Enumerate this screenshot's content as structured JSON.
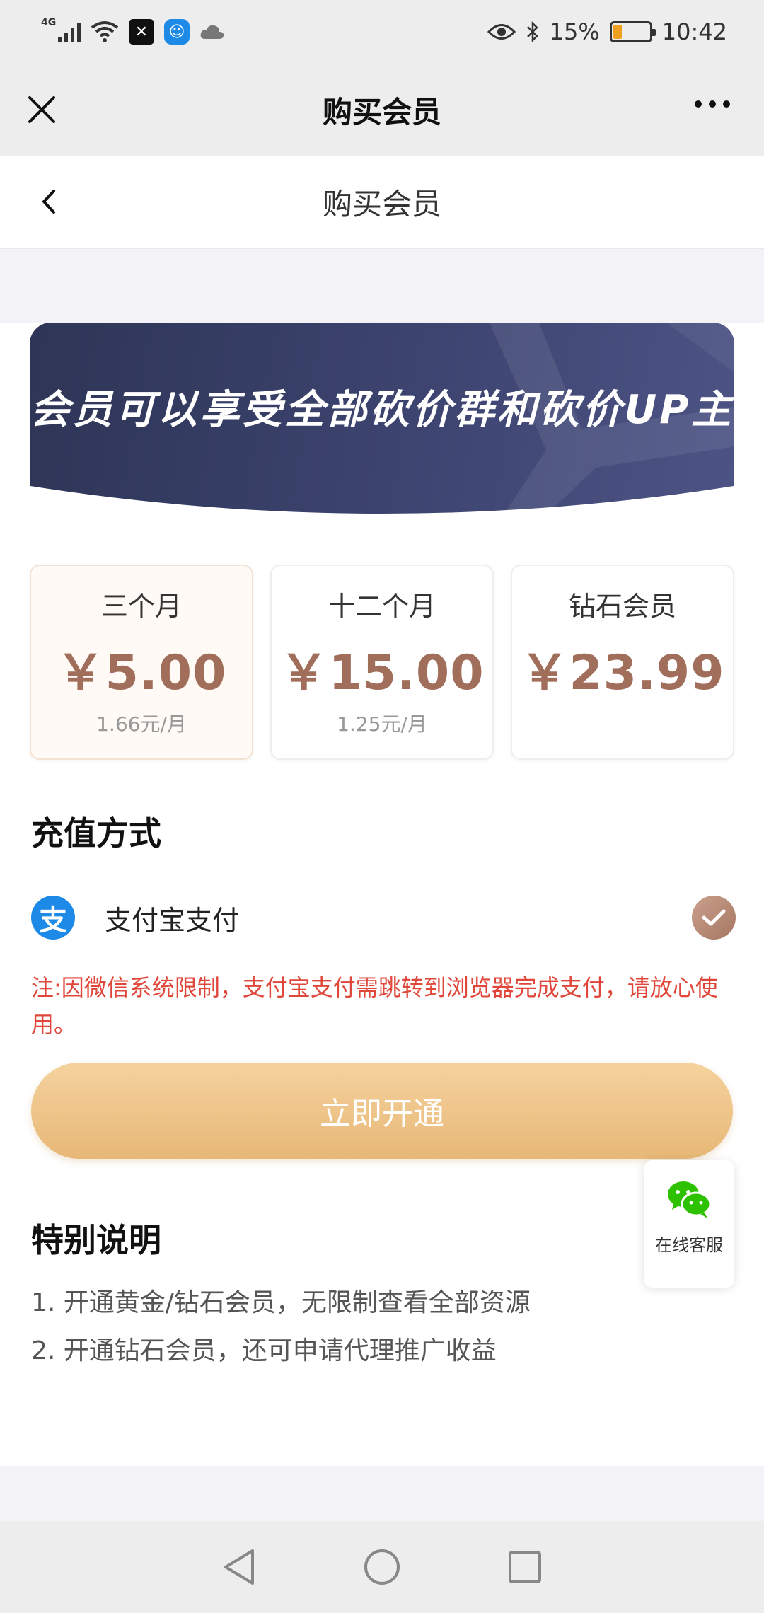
{
  "status_bar": {
    "network": "4G",
    "battery": "15%",
    "time": "10:42"
  },
  "wechat_nav": {
    "title": "购买会员"
  },
  "page_header": {
    "title": "购买会员"
  },
  "banner": {
    "text": "会员可以享受全部砍价群和砍价UP主"
  },
  "plans": [
    {
      "name": "三个月",
      "price": "￥5.00",
      "per_month": "1.66元/月",
      "selected": true
    },
    {
      "name": "十二个月",
      "price": "￥15.00",
      "per_month": "1.25元/月",
      "selected": false
    },
    {
      "name": "钻石会员",
      "price": "￥23.99",
      "per_month": "",
      "selected": false
    }
  ],
  "payment": {
    "section_title": "充值方式",
    "method_label": "支付宝支付",
    "alipay_glyph": "支",
    "note": "注:因微信系统限制，支付宝支付需跳转到浏览器完成支付，请放心使用。",
    "submit_label": "立即开通"
  },
  "special": {
    "title": "特别说明",
    "items": [
      "1. 开通黄金/钻石会员，无限制查看全部资源",
      "2. 开通钻石会员，还可申请代理推广收益"
    ]
  },
  "service": {
    "label": "在线客服"
  },
  "colors": {
    "accent_price": "#a06e5a",
    "note_red": "#e0473a",
    "button_gold": "#e7b877",
    "banner_navy": "#2e3556"
  }
}
